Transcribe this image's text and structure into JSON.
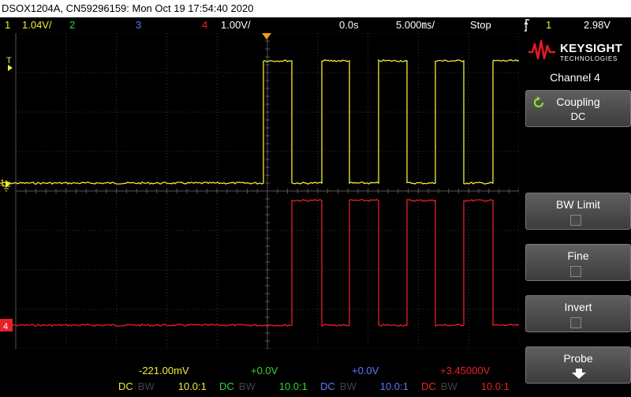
{
  "window": {
    "title": "DSOX1204A, CN59296159: Mon Oct 19 17:54:40 2020"
  },
  "status": {
    "ch1_num": "1",
    "ch1_scale": "1.04V/",
    "ch2_num": "2",
    "ch3_num": "3",
    "ch4_num": "4",
    "ch4_scale": "1.00V/",
    "time_delay": "0.0s",
    "time_scale": "5.000㎳/",
    "run_state": "Stop",
    "trigger_icon": "trigger-edge-icon",
    "trigger_source": "1",
    "trigger_level": "2.98V"
  },
  "sidebar": {
    "brand": "KEYSIGHT",
    "brand_sub": "TECHNOLOGIES",
    "menu_title": "Channel 4",
    "softkeys": [
      {
        "label": "Coupling",
        "value": "DC"
      },
      {
        "label": "BW Limit"
      },
      {
        "label": "Fine"
      },
      {
        "label": "Invert"
      },
      {
        "label": "Probe"
      }
    ]
  },
  "screen": {
    "trigger_marker": "T",
    "ch1_ground": "1",
    "ch4_ground": "4"
  },
  "bottom": {
    "ch1": {
      "offset": "-221.00mV",
      "coupling": "DC",
      "bw": "BW",
      "probe": "10.0:1"
    },
    "ch2": {
      "offset": "+0.0V",
      "coupling": "DC",
      "bw": "BW",
      "probe": "10.0:1"
    },
    "ch3": {
      "offset": "+0.0V",
      "coupling": "DC",
      "bw": "BW",
      "probe": "10.0:1"
    },
    "ch4": {
      "offset": "+3.45000V",
      "coupling": "DC",
      "bw": "BW",
      "probe": "10.0:1"
    }
  },
  "colors": {
    "ch1": "#f2ec3a",
    "ch2": "#35d33a",
    "ch3": "#5878ff",
    "ch4": "#e8202a",
    "grid": "#3a3a3a",
    "accent": "#f39a1e",
    "brand": "#e31b23"
  }
}
